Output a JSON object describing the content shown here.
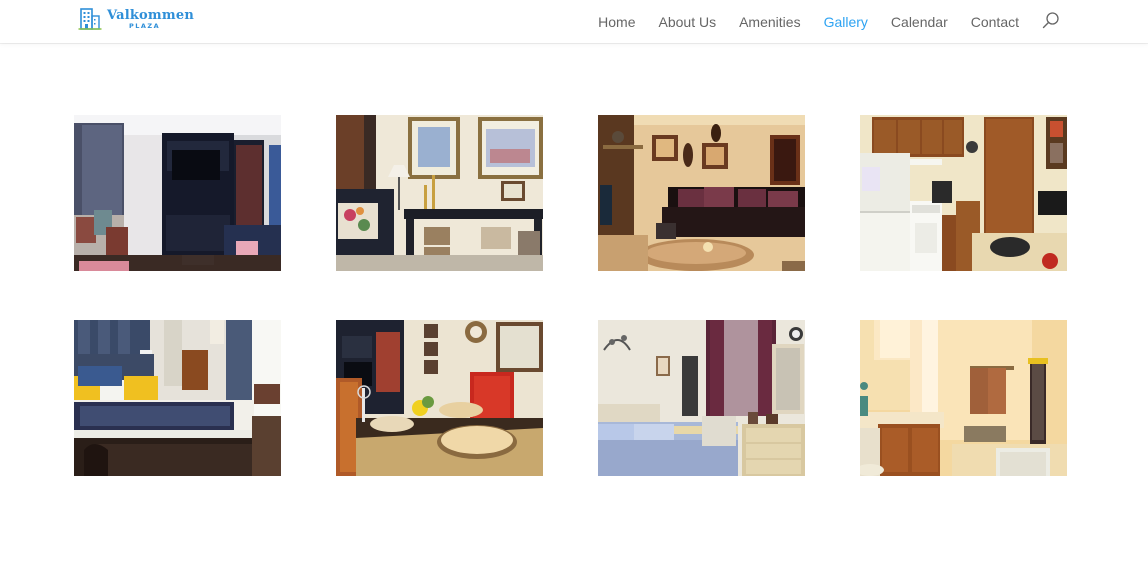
{
  "header": {
    "logo": {
      "name": "Valkommen",
      "sub": "PLAZA",
      "icon": "building-icon",
      "brand_color": "#2f8fd8"
    },
    "nav": [
      {
        "label": "Home",
        "active": false
      },
      {
        "label": "About Us",
        "active": false
      },
      {
        "label": "Amenities",
        "active": false
      },
      {
        "label": "Gallery",
        "active": true
      },
      {
        "label": "Calendar",
        "active": false
      },
      {
        "label": "Contact",
        "active": false
      }
    ],
    "search_icon": "search-icon",
    "active_color": "#2ea3f2",
    "nav_color": "#666666"
  },
  "gallery": {
    "images": [
      {
        "subject": "living room with entertainment center"
      },
      {
        "subject": "living room with console table and framed art"
      },
      {
        "subject": "living room with leather sofa"
      },
      {
        "subject": "kitchen"
      },
      {
        "subject": "bedroom with blue bedding"
      },
      {
        "subject": "dining table set"
      },
      {
        "subject": "bedroom with dresser and mirror"
      },
      {
        "subject": "bathroom"
      }
    ]
  }
}
